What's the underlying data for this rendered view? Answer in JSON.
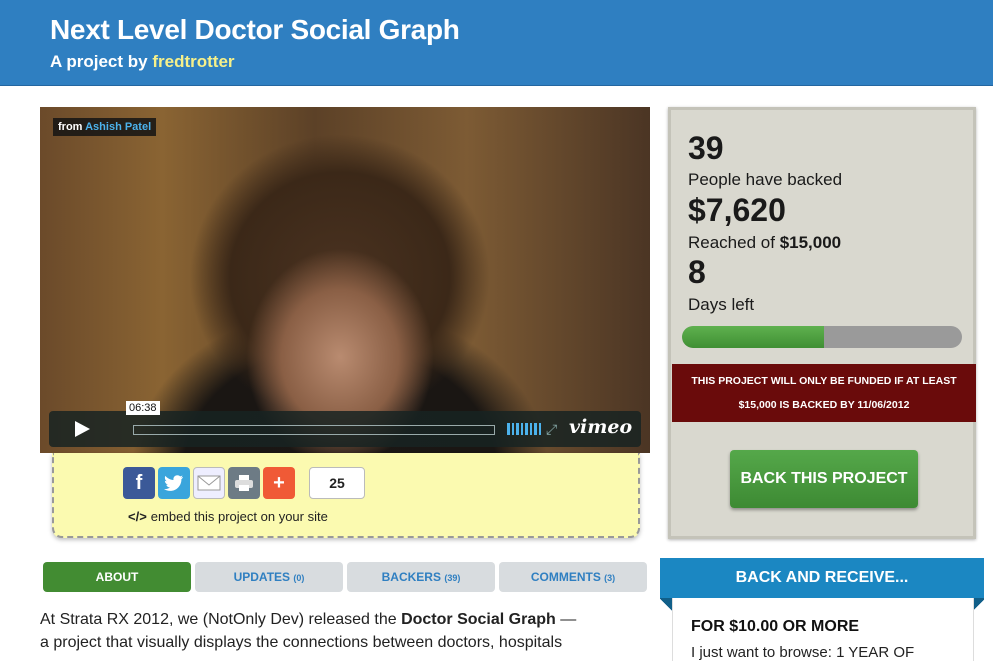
{
  "header": {
    "title": "Next Level Doctor Social Graph",
    "byline_prefix": "A project by",
    "author": "fredtrotter"
  },
  "video": {
    "from_prefix": "from",
    "from_author": "Ashish Patel",
    "timecode": "06:38",
    "player_logo": "vimeo",
    "icons": [
      "play-icon",
      "volume-icon",
      "fullscreen-icon"
    ]
  },
  "share": {
    "icons": [
      "facebook-icon",
      "twitter-icon",
      "email-icon",
      "print-icon",
      "plus-icon"
    ],
    "count": "25",
    "embed_symbol": "</>",
    "embed_text": "embed this project on your site"
  },
  "stats": {
    "backers_count": "39",
    "backers_label": "People have backed",
    "pledged": "$7,620",
    "reached_prefix": "Reached of",
    "goal": "$15,000",
    "days_count": "8",
    "days_label": "Days left",
    "progress_fraction": 0.508,
    "notice_line1": "THIS PROJECT WILL ONLY BE FUNDED IF AT LEAST",
    "notice_line2": "$15,000 IS BACKED BY 11/06/2012",
    "back_button": "BACK THIS PROJECT"
  },
  "tabs": [
    {
      "label": "ABOUT",
      "count": ""
    },
    {
      "label": "UPDATES",
      "count": "(0)"
    },
    {
      "label": "BACKERS",
      "count": "(39)"
    },
    {
      "label": "COMMENTS",
      "count": "(3)"
    }
  ],
  "description": {
    "line1_prefix": "At Strata RX 2012, we (NotOnly Dev) released the",
    "line1_bold": "Doctor Social Graph",
    "line1_suffix": "—",
    "line2": "a project that visually displays the connections between doctors, hospitals"
  },
  "rewards": {
    "heading": "BACK AND RECEIVE...",
    "amount": "FOR $10.00 OR MORE",
    "text": "I just want to browse: 1 YEAR OF"
  },
  "colors": {
    "header_blue": "#2f7fc1",
    "author_yellow": "#f5f08a",
    "share_bg": "#fbfab0",
    "stats_bg": "#d9d8cf",
    "progress_green": "#4fa043",
    "notice_red": "#6a0b0b",
    "button_green": "#4a9a3f",
    "active_tab": "#428c32",
    "rewards_blue": "#1b87c2"
  }
}
